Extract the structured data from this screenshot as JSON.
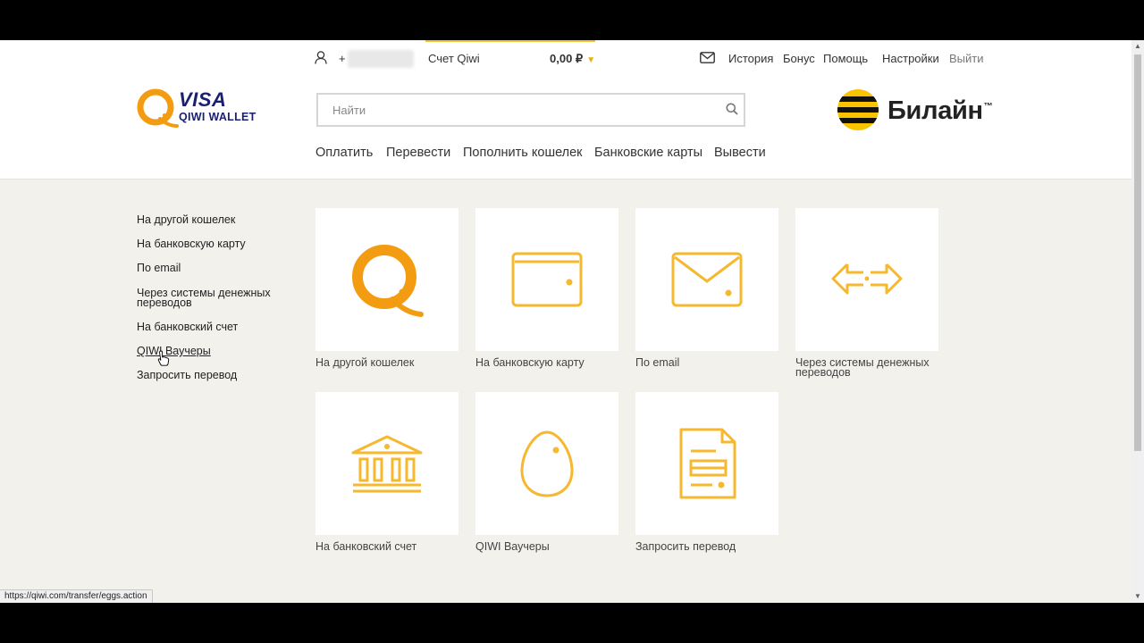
{
  "topbar": {
    "phone_prefix": "+",
    "account_label": "Счет Qiwi",
    "balance": "0,00 ₽",
    "links": [
      "История",
      "Бонус",
      "Помощь",
      "Настройки",
      "Выйти"
    ]
  },
  "logo": {
    "visa": "VISA",
    "wallet": "QIWI WALLET"
  },
  "search": {
    "placeholder": "Найти"
  },
  "brand": {
    "name": "Билайн",
    "tm": "™"
  },
  "nav": {
    "tabs": [
      "Оплатить",
      "Перевести",
      "Пополнить кошелек",
      "Банковские карты",
      "Вывести"
    ],
    "active": "Перевести"
  },
  "sidebar": {
    "items": [
      "На другой кошелек",
      "На банковскую карту",
      "По email",
      "Через системы денежных переводов",
      "На банковский счет",
      "QIWI Ваучеры",
      "Запросить перевод"
    ]
  },
  "tiles": [
    {
      "label": "На другой кошелек",
      "icon": "qiwi-logo-icon"
    },
    {
      "label": "На банковскую карту",
      "icon": "card-icon"
    },
    {
      "label": "По email",
      "icon": "envelope-icon"
    },
    {
      "label": "Через системы денежных переводов",
      "icon": "exchange-arrows-icon"
    },
    {
      "label": "На банковский счет",
      "icon": "bank-icon"
    },
    {
      "label": "QIWI Ваучеры",
      "icon": "egg-icon"
    },
    {
      "label": "Запросить перевод",
      "icon": "document-icon"
    }
  ],
  "statusbar": {
    "url": "https://qiwi.com/transfer/eggs.action"
  },
  "colors": {
    "accent": "#f5b021",
    "icon": "#f5b82e",
    "visa_blue": "#1a1f71",
    "qiwi_orange": "#f39c12"
  }
}
